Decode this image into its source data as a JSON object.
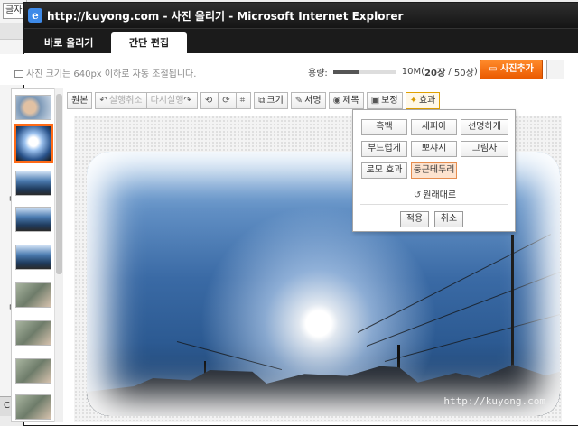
{
  "background_app": {
    "tab_label": "글자",
    "footer_label": "C",
    "bullets": [
      "ㅁ",
      "ㅁ",
      "ㅁ"
    ]
  },
  "window": {
    "title": "http://kuyong.com - 사진 올리기 - Microsoft Internet Explorer"
  },
  "tabs": [
    {
      "label": "바로 올리기"
    },
    {
      "label": "간단 편집"
    }
  ],
  "notice": "사진 크기는 640px 이하로 자동 조절됩니다.",
  "capacity": {
    "label": "용량:",
    "used": "10M",
    "count": "20장",
    "total": "50장",
    "fill_fraction": 0.4
  },
  "buttons": {
    "add_photo": "사진추가"
  },
  "toolbar": {
    "original": "원본",
    "undo": "실행취소",
    "redo": "다시실행",
    "resize": "크기",
    "signature": "서명",
    "title": "제목",
    "correct": "보정",
    "effects": "효과"
  },
  "effects_menu": {
    "options": [
      "흑백",
      "세피아",
      "선명하게",
      "부드럽게",
      "뽀샤시",
      "그림자",
      "로모 효과",
      "둥근테두리"
    ],
    "selected": "둥근테두리",
    "reset": "원래대로",
    "apply": "적용",
    "cancel": "취소"
  },
  "watermark": "http://kuyong.com",
  "icons": [
    "ie-logo-icon",
    "camera-icon",
    "undo-icon",
    "redo-icon",
    "rotate-left-icon",
    "rotate-right-icon",
    "crop-icon",
    "resize-icon",
    "pen-icon",
    "eye-icon",
    "monitor-icon",
    "wand-icon"
  ]
}
